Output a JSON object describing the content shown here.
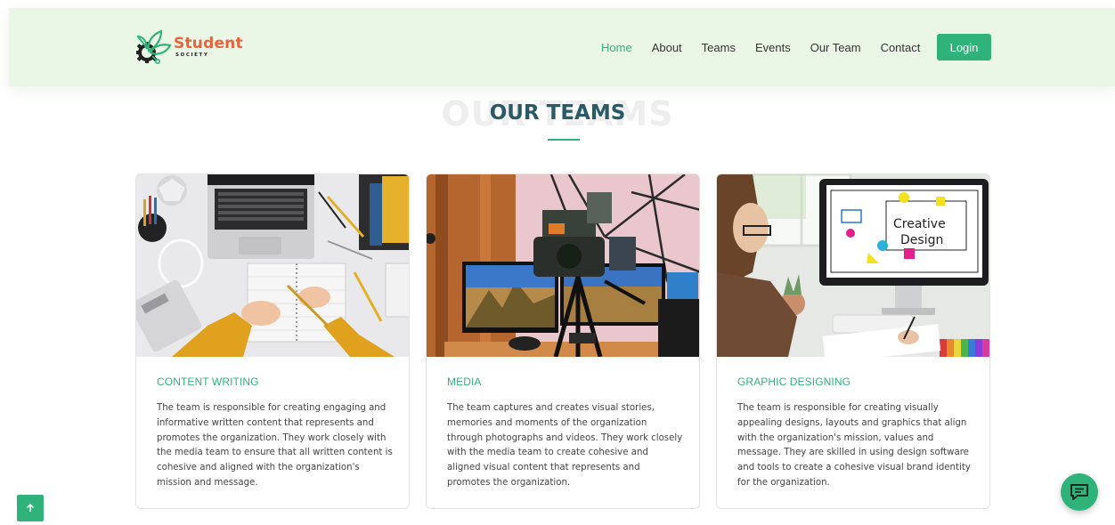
{
  "brand": {
    "name": "Student",
    "sub": "SOCIETY",
    "colors": {
      "accent": "#2fb37a",
      "logo_orange": "#e8633a",
      "header_bg": "#eaf6e6",
      "title": "#2b5a67"
    }
  },
  "nav": {
    "items": [
      "Home",
      "About",
      "Teams",
      "Events",
      "Our Team",
      "Contact"
    ],
    "active": "Home",
    "login_label": "Login"
  },
  "section": {
    "ghost_title": "OUR TEAMS",
    "title": "OUR TEAMS"
  },
  "cards": [
    {
      "title": "CONTENT WRITING",
      "text": "The team is responsible for creating engaging and informative written content that represents and promotes the organization. They work closely with the media team to ensure that all written content is cohesive and aligned with the organization's mission and message.",
      "image": "content-writing-photo"
    },
    {
      "title": "MEDIA",
      "text": "The team captures and creates visual stories, memories and moments of the organization through photographs and videos. They work closely with the media team to create cohesive and aligned visual content that represents and promotes the organization.",
      "image": "media-photo"
    },
    {
      "title": "GRAPHIC DESIGNING",
      "text": "The team is responsible for creating visually appealing designs, layouts and graphics that align with the organization's mission, values and message. They are skilled in using design software and tools to create a cohesive visual brand identity for the organization.",
      "image": "graphic-design-photo",
      "screen_text": [
        "Creative",
        "Design"
      ]
    }
  ],
  "icons": {
    "scroll_top": "arrow-up-icon",
    "chat": "chat-icon"
  }
}
